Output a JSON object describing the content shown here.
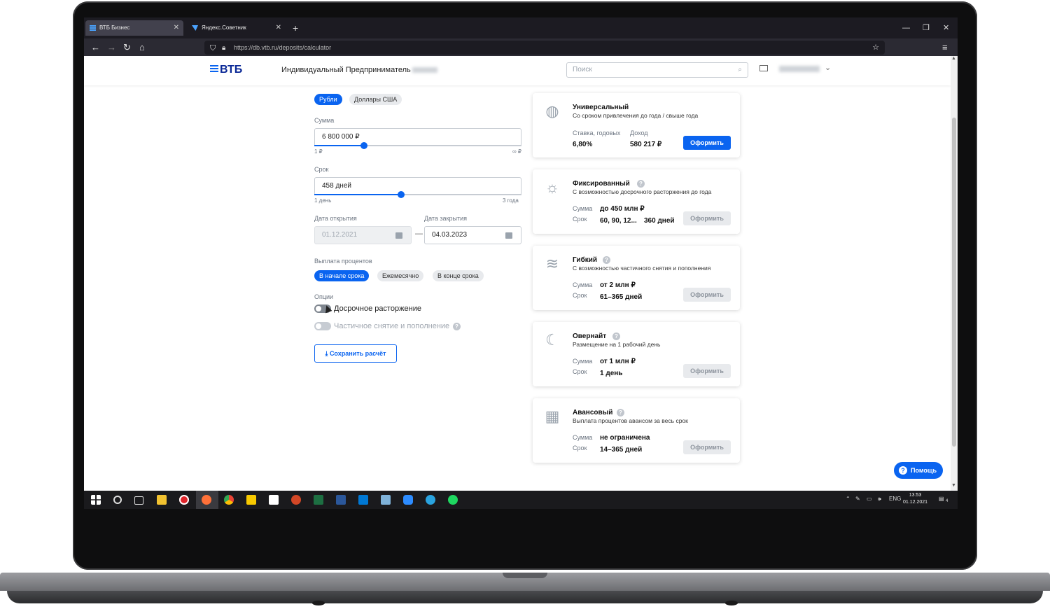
{
  "browser": {
    "tabs": [
      {
        "label": "ВТБ Бизнес",
        "active": true
      },
      {
        "label": "Яндекс.Советник",
        "active": false
      }
    ],
    "new_tab": "+",
    "url": "https://db.vtb.ru/deposits/calculator",
    "url_host": "db.vtb.ru",
    "controls": {
      "minimize": "—",
      "restore": "❐",
      "close": "✕"
    }
  },
  "header": {
    "logo": "ВТБ",
    "org_name": "Индивидуальный Предприниматель",
    "search_placeholder": "Поиск"
  },
  "form": {
    "currency_tabs": [
      {
        "label": "Рубли",
        "selected": true
      },
      {
        "label": "Доллары США",
        "selected": false
      }
    ],
    "amount": {
      "label": "Сумма",
      "value": "6 800 000 ₽",
      "min": "1 ₽",
      "max": "∞ ₽",
      "slider_fraction": 0.24
    },
    "term": {
      "label": "Срок",
      "value": "458 дней",
      "min": "1 день",
      "max": "3 года",
      "slider_fraction": 0.42
    },
    "open_date": {
      "label": "Дата открытия",
      "value": "01.12.2021"
    },
    "close_date": {
      "label": "Дата закрытия",
      "value": "04.03.2023"
    },
    "date_separator": "—",
    "payout": {
      "label": "Выплата процентов",
      "options": [
        {
          "label": "В начале срока",
          "selected": true
        },
        {
          "label": "Ежемесячно",
          "selected": false
        },
        {
          "label": "В конце срока",
          "selected": false
        }
      ]
    },
    "options": {
      "label": "Опции",
      "early_termination": {
        "label": "Досрочное расторжение",
        "enabled": false
      },
      "partial_withdrawal": {
        "label": "Частичное снятие и пополнение",
        "enabled": false
      }
    },
    "save_button": "Сохранить расчёт"
  },
  "cards": [
    {
      "title": "Универсальный",
      "subtitle": "Со сроком привлечения до года / свыше года",
      "icon": "globe-icon",
      "rate_label": "Ставка, годовых",
      "rate_value": "6,80%",
      "income_label": "Доход",
      "income_value": "580 217 ₽",
      "button": "Оформить",
      "button_enabled": true
    },
    {
      "title": "Фиксированный",
      "subtitle": "С возможностью досрочного расторжения до года",
      "icon": "sun-mountain-icon",
      "sum_label": "Сумма",
      "sum_value": "до 450 млн ₽",
      "term_label": "Срок",
      "term_value": "60, 90, 12...",
      "term_value2": "360 дней",
      "button": "Оформить",
      "button_enabled": false
    },
    {
      "title": "Гибкий",
      "subtitle": "С возможностью частичного снятия и пополнения",
      "icon": "waves-icon",
      "sum_label": "Сумма",
      "sum_value": "от 2 млн ₽",
      "term_label": "Срок",
      "term_value": "61–365 дней",
      "button": "Оформить",
      "button_enabled": false
    },
    {
      "title": "Овернайт",
      "subtitle": "Размещение на 1 рабочий день",
      "icon": "moon-cloud-icon",
      "sum_label": "Сумма",
      "sum_value": "от 1 млн ₽",
      "term_label": "Срок",
      "term_value": "1 день",
      "button": "Оформить",
      "button_enabled": false
    },
    {
      "title": "Авансовый",
      "subtitle": "Выплата процентов авансом за весь срок",
      "icon": "calendar-icon",
      "sum_label": "Сумма",
      "sum_value": "не ограничена",
      "term_label": "Срок",
      "term_value": "14–365 дней",
      "button": "Оформить",
      "button_enabled": false
    }
  ],
  "help_button": "Помощь",
  "taskbar": {
    "lang": "ENG",
    "time": "13:53",
    "date": "01.12.2021",
    "notifications": "4"
  },
  "colors": {
    "accent": "#0a64f0",
    "brand": "#0a2896"
  }
}
